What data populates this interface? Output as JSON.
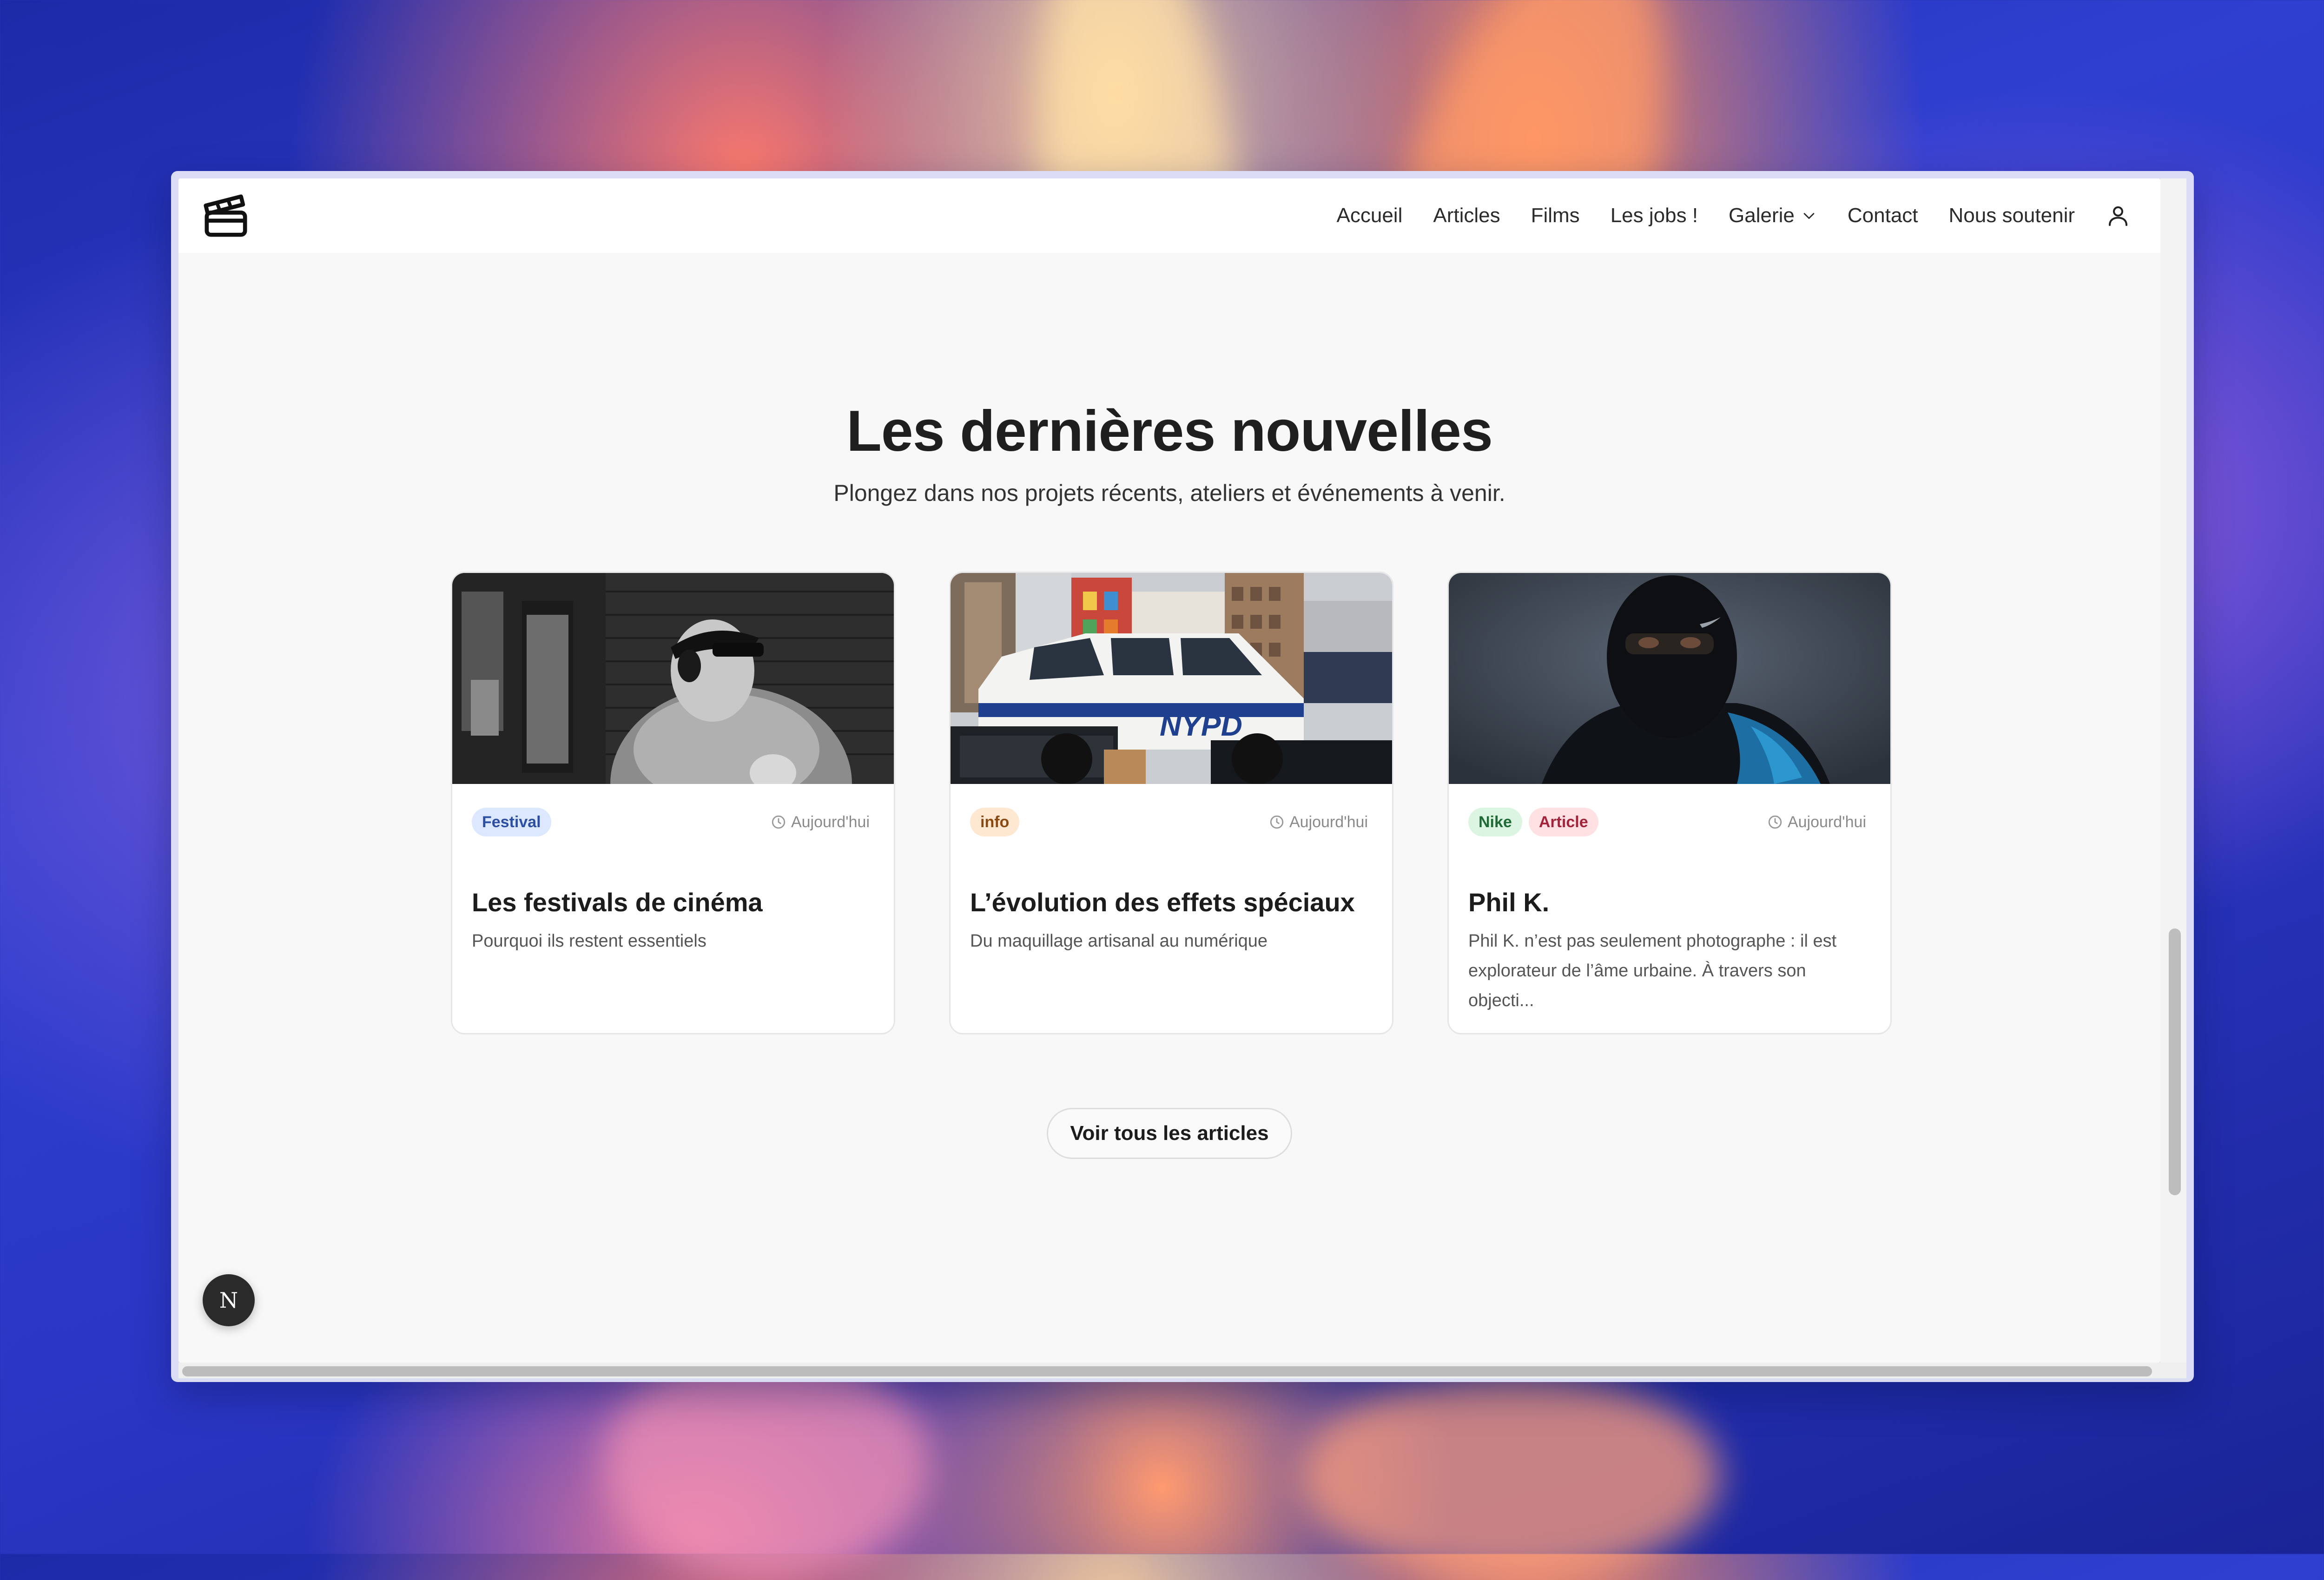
{
  "nav": {
    "links": [
      "Accueil",
      "Articles",
      "Films",
      "Les jobs !",
      "Galerie",
      "Contact",
      "Nous soutenir"
    ]
  },
  "hero": {
    "title": "Les dernières nouvelles",
    "subtitle": "Plongez dans nos projets récents, ateliers et événements à venir."
  },
  "cards": [
    {
      "tags": [
        {
          "label": "Festival",
          "bg": "#dbe8ff",
          "fg": "#2d4fa3"
        }
      ],
      "date": "Aujourd'hui",
      "title": "Les festivals de cinéma",
      "text": "Pourquoi ils restent essentiels"
    },
    {
      "tags": [
        {
          "label": "info",
          "bg": "#ffe8d2",
          "fg": "#8a4a12"
        }
      ],
      "date": "Aujourd'hui",
      "title": "L’évolution des effets spéciaux",
      "text": "Du maquillage artisanal au numérique"
    },
    {
      "tags": [
        {
          "label": "Nike",
          "bg": "#dcf5e2",
          "fg": "#1e6b35"
        },
        {
          "label": "Article",
          "bg": "#ffe0e3",
          "fg": "#a3243a"
        }
      ],
      "date": "Aujourd'hui",
      "title": "Phil K.",
      "text": "Phil K. n’est pas seulement photographe : il est explorateur de l’âme urbaine. À travers son objecti..."
    }
  ],
  "cta": {
    "label": "Voir tous les articles"
  },
  "badge": {
    "label": "N"
  },
  "icons": {
    "logo": "clapperboard-icon",
    "galerie": "chevron-down-icon",
    "user": "user-icon",
    "date": "clock-icon"
  }
}
